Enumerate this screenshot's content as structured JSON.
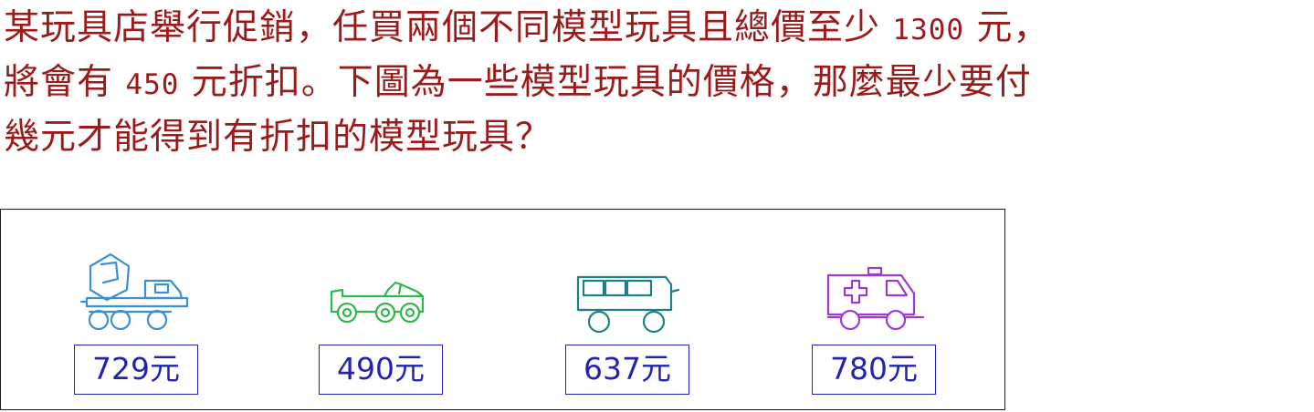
{
  "question": {
    "line1_a": "某玩具店舉行促銷，任買兩個不同模型玩具且總價至少 ",
    "line1_num": "1300",
    "line1_b": " 元，",
    "line2_a": "將會有 ",
    "line2_num": "450",
    "line2_b": " 元折扣。下圖為一些模型玩具的價格，那麼最少要付",
    "line3": "幾元才能得到有折扣的模型玩具？"
  },
  "toys": [
    {
      "icon": "cement-mixer-truck-icon",
      "color": "#3b8fd6",
      "price": "729元"
    },
    {
      "icon": "jeep-icon",
      "color": "#2fb84a",
      "price": "490元"
    },
    {
      "icon": "bus-icon",
      "color": "#1f7f86",
      "price": "637元"
    },
    {
      "icon": "ambulance-icon",
      "color": "#9b3ad6",
      "price": "780元"
    }
  ]
}
